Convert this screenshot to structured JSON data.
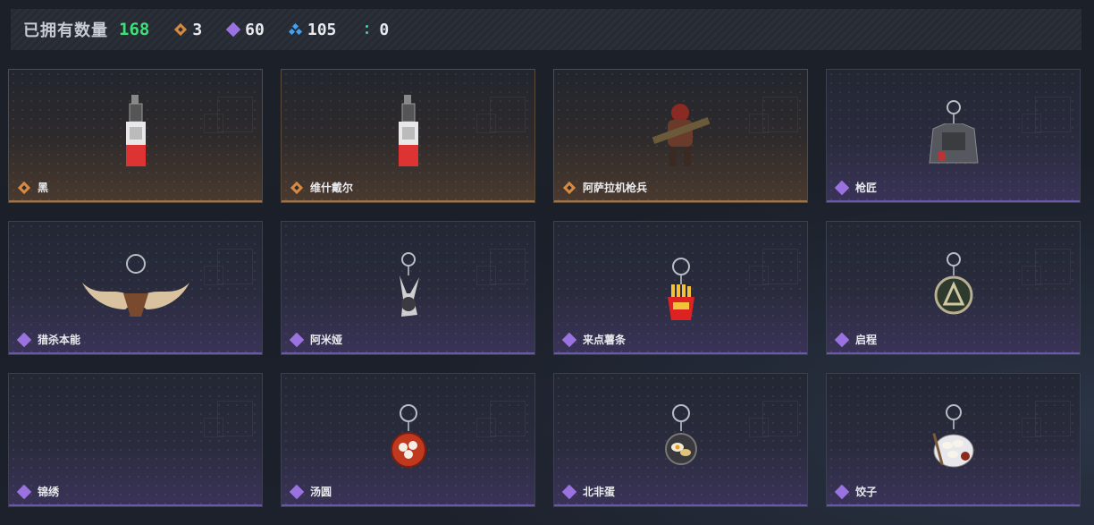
{
  "header": {
    "owned_label": "已拥有数量",
    "owned_count": "168",
    "stats": [
      {
        "icon": "orange-diamond-icon",
        "value": "3",
        "color": "#d98a3e"
      },
      {
        "icon": "purple-diamond-icon",
        "value": "60",
        "color": "#9b73e0"
      },
      {
        "icon": "blue-triangle-icon",
        "value": "105",
        "color": "#4aa0e8"
      },
      {
        "icon": "green-dots-icon",
        "value": "0",
        "color": "#43d6a0"
      }
    ]
  },
  "cards": [
    {
      "name": "黑",
      "rarity": "orange",
      "charm": "red-device"
    },
    {
      "name": "维什戴尔",
      "rarity": "orange",
      "charm": "red-device"
    },
    {
      "name": "阿萨拉机枪兵",
      "rarity": "orange",
      "charm": "gunner-figure"
    },
    {
      "name": "枪匠",
      "rarity": "purple",
      "charm": "vest"
    },
    {
      "name": "猎杀本能",
      "rarity": "purple",
      "charm": "antlers"
    },
    {
      "name": "阿米娅",
      "rarity": "purple",
      "charm": "rabbit"
    },
    {
      "name": "来点薯条",
      "rarity": "purple",
      "charm": "fries"
    },
    {
      "name": "启程",
      "rarity": "purple",
      "charm": "badge"
    },
    {
      "name": "锦绣",
      "rarity": "purple",
      "charm": "none"
    },
    {
      "name": "汤圆",
      "rarity": "purple",
      "charm": "soup-bowl"
    },
    {
      "name": "北非蛋",
      "rarity": "purple",
      "charm": "egg-pan"
    },
    {
      "name": "饺子",
      "rarity": "purple",
      "charm": "dumpling-plate"
    }
  ]
}
